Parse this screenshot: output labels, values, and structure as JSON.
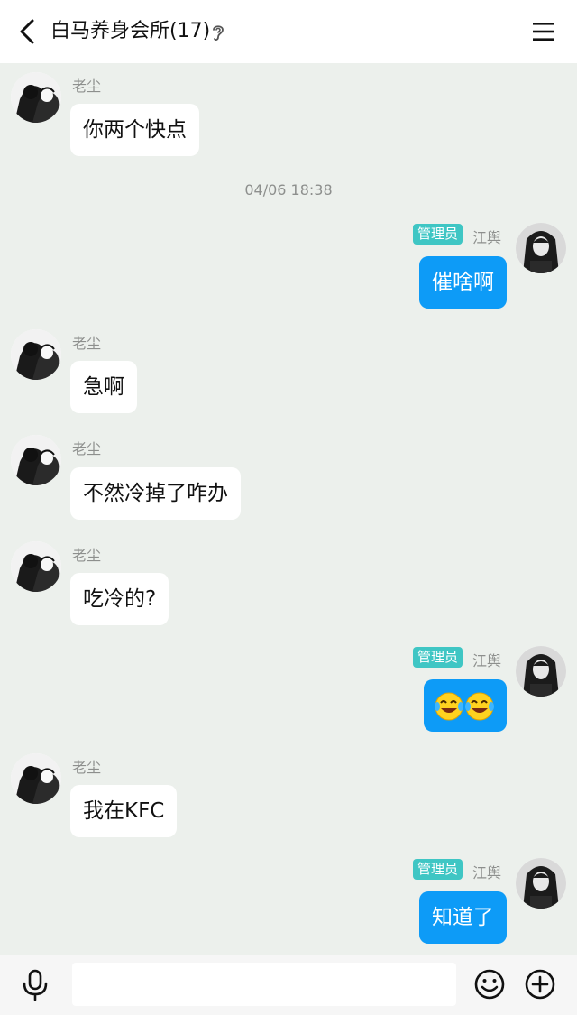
{
  "header": {
    "title": "白马养身会所(17)"
  },
  "timestamp": "04/06 18:38",
  "messages": [
    {
      "sender": "老尘",
      "text": "你两个快点"
    },
    {
      "sender": "江舆",
      "badge": "管理员",
      "text": "催啥啊"
    },
    {
      "sender": "老尘",
      "text": "急啊"
    },
    {
      "sender": "老尘",
      "text": "不然冷掉了咋办"
    },
    {
      "sender": "老尘",
      "text": "吃冷的?"
    },
    {
      "sender": "江舆",
      "badge": "管理员",
      "text": ""
    },
    {
      "sender": "老尘",
      "text": "我在KFC"
    },
    {
      "sender": "江舆",
      "badge": "管理员",
      "text": "知道了"
    }
  ],
  "input": {
    "value": ""
  },
  "colors": {
    "background": "#ecf0ec",
    "outgoing_bubble": "#0d9bf7",
    "admin_badge": "#3fc6c4"
  },
  "icons": {
    "back": "chevron-left-icon",
    "ear": "ear-icon",
    "menu": "menu-icon",
    "mic": "microphone-icon",
    "emoji": "smiley-icon",
    "plus": "plus-circle-icon",
    "emoji_message": "laughing-crying-emoji"
  }
}
